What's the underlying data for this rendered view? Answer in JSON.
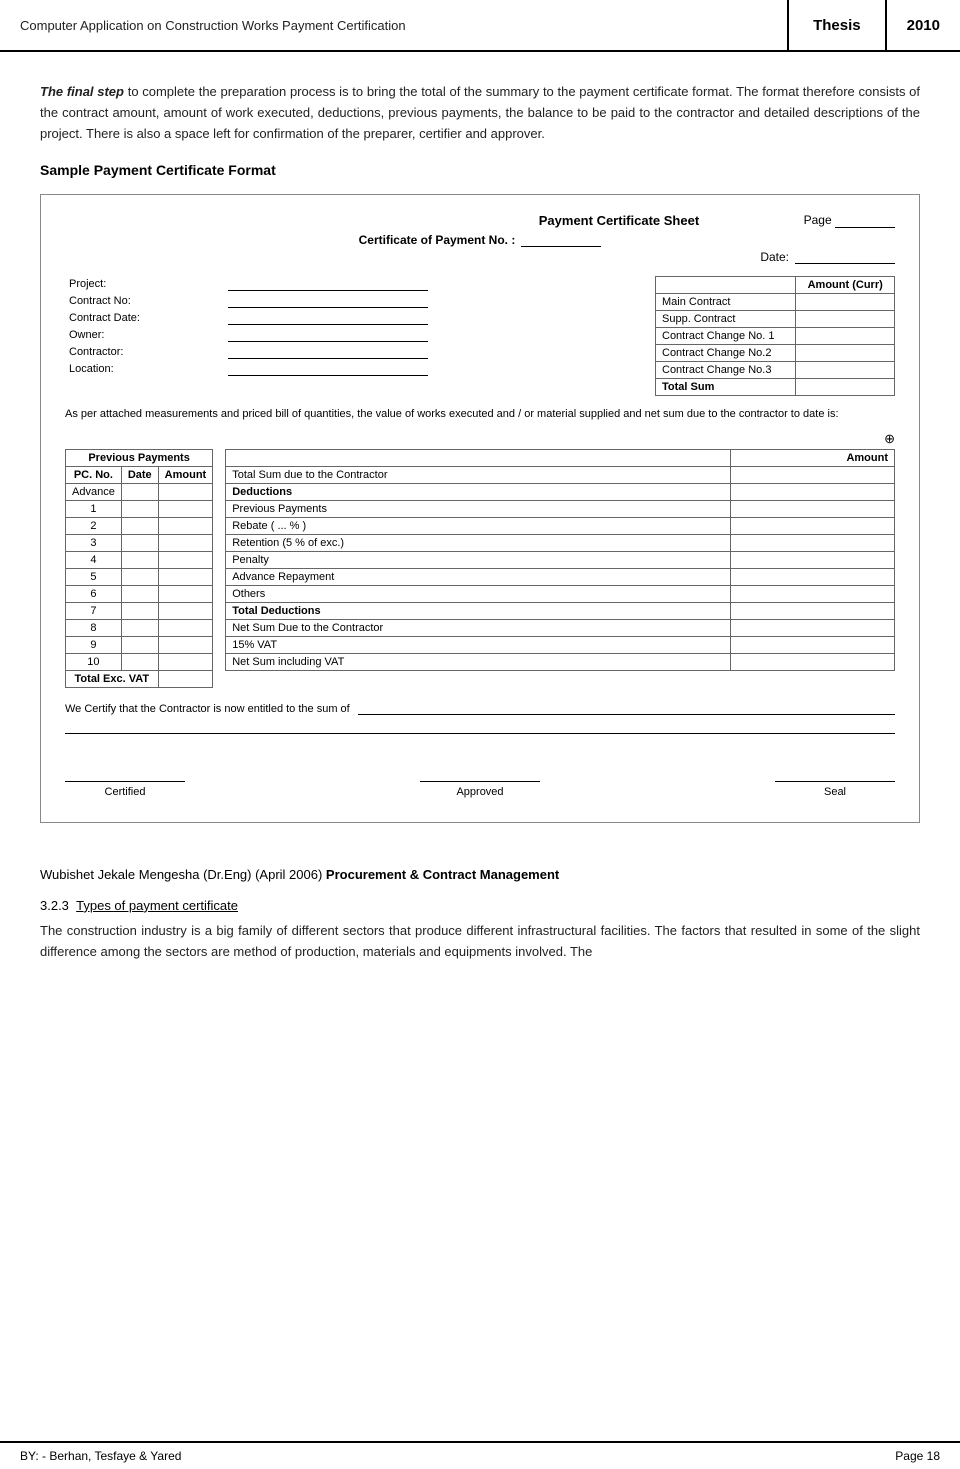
{
  "header": {
    "title": "Computer Application on Construction Works Payment Certification",
    "thesis": "Thesis",
    "year": "2010"
  },
  "paragraphs": {
    "p1": "The final step to complete the preparation process is to bring the total of the summary to the payment certificate format. The format therefore consists of the contract amount, amount of work executed, deductions, previous payments, the balance to be paid to the contractor and detailed descriptions of the project. There is also a space left for confirmation of the preparer, certifier and approver.",
    "p1_bold_italic": "The final step",
    "section_heading": "Sample Payment Certificate Format"
  },
  "certificate": {
    "page_label": "Page",
    "title": "Payment Certificate Sheet",
    "subtitle": "Certificate of Payment No. :",
    "date_label": "Date:",
    "project_fields": [
      {
        "label": "Project:"
      },
      {
        "label": "Contract No:"
      },
      {
        "label": "Contract Date:"
      },
      {
        "label": "Owner:"
      },
      {
        "label": "Contractor:"
      },
      {
        "label": "Location:"
      }
    ],
    "amounts_header": "Amount (Curr)",
    "amounts_rows": [
      {
        "label": "Main Contract",
        "amount": ""
      },
      {
        "label": "Supp. Contract",
        "amount": ""
      },
      {
        "label": "Contract Change No. 1",
        "amount": ""
      },
      {
        "label": "Contract Change No.2",
        "amount": ""
      },
      {
        "label": "Contract Change No.3",
        "amount": ""
      },
      {
        "label": "Total Sum",
        "amount": "",
        "bold": true
      }
    ],
    "measurement_text": "As per attached measurements and priced bill of quantities, the value of works executed and / or material supplied and net sum due to the contractor to date is:",
    "prev_payments_header": "Previous Payments",
    "prev_payments_cols": [
      "PC. No.",
      "Date",
      "Amount"
    ],
    "prev_payments_rows": [
      {
        "no": "Advance",
        "date": "",
        "amount": ""
      },
      {
        "no": "1",
        "date": "",
        "amount": ""
      },
      {
        "no": "2",
        "date": "",
        "amount": ""
      },
      {
        "no": "3",
        "date": "",
        "amount": ""
      },
      {
        "no": "4",
        "date": "",
        "amount": ""
      },
      {
        "no": "5",
        "date": "",
        "amount": ""
      },
      {
        "no": "6",
        "date": "",
        "amount": ""
      },
      {
        "no": "7",
        "date": "",
        "amount": ""
      },
      {
        "no": "8",
        "date": "",
        "amount": ""
      },
      {
        "no": "9",
        "date": "",
        "amount": ""
      },
      {
        "no": "10",
        "date": "",
        "amount": ""
      },
      {
        "no": "Total Exc. VAT",
        "date": "",
        "amount": "",
        "bold": true
      }
    ],
    "right_table_header": "Amount",
    "right_table_rows": [
      {
        "label": "Total Sum due to the Contractor",
        "amount": "",
        "bold": false
      },
      {
        "label": "Deductions",
        "amount": "",
        "bold": true
      },
      {
        "label": "Previous Payments",
        "amount": "",
        "bold": false
      },
      {
        "label": "Rebate ( ... % )",
        "amount": "",
        "bold": false
      },
      {
        "label": "Retention (5 % of exc.)",
        "amount": "",
        "bold": false
      },
      {
        "label": "Penalty",
        "amount": "",
        "bold": false
      },
      {
        "label": "Advance Repayment",
        "amount": "",
        "bold": false
      },
      {
        "label": "Others",
        "amount": "",
        "bold": false
      },
      {
        "label": "Total Deductions",
        "amount": "",
        "bold": true
      },
      {
        "label": "Net Sum Due to the Contractor",
        "amount": "",
        "bold": false
      },
      {
        "label": "15% VAT",
        "amount": "",
        "bold": false
      },
      {
        "label": "Net Sum including VAT",
        "amount": "",
        "bold": false
      }
    ],
    "certify_text": "We Certify that the Contractor is now entitled to the sum of",
    "certified_label": "Certified",
    "approved_label": "Approved",
    "seal_label": "Seal"
  },
  "footer": {
    "author": "BY: - Berhan, Tesfaye & Yared",
    "page": "Page 18"
  },
  "bottom": {
    "author_line": "Wubishet Jekale Mengesha (Dr.Eng) (April 2006)",
    "bold_part": "Procurement & Contract Management",
    "subsection": "3.2.3  Types of payment certificate",
    "subsection_underline": "Types of payment certificate",
    "para2": "The construction industry is a big family of different sectors that produce different infrastructural facilities. The factors that resulted in some of the slight difference among the sectors are method of production, materials and equipments involved. The"
  }
}
